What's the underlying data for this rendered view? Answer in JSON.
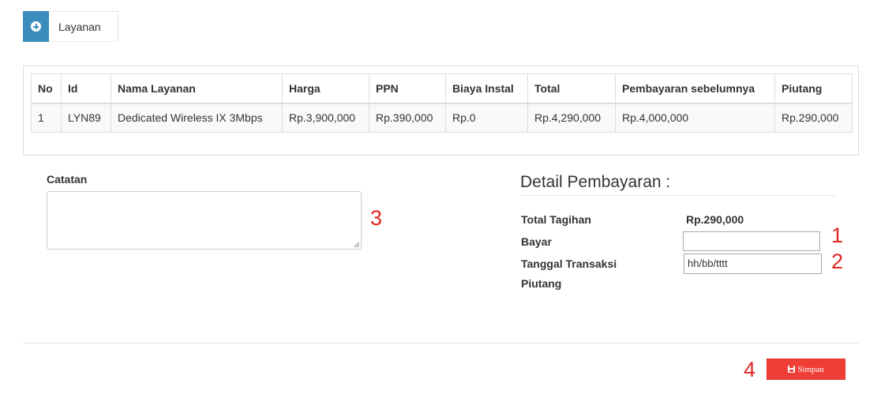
{
  "tab": {
    "label": "Layanan",
    "icon": "plus-circle-icon"
  },
  "table": {
    "headers": [
      "No",
      "Id",
      "Nama Layanan",
      "Harga",
      "PPN",
      "Biaya Instal",
      "Total",
      "Pembayaran sebelumnya",
      "Piutang"
    ],
    "rows": [
      [
        "1",
        "LYN89",
        "Dedicated Wireless IX 3Mbps",
        "Rp.3,900,000",
        "Rp.390,000",
        "Rp.0",
        "Rp.4,290,000",
        "Rp.4,000,000",
        "Rp.290,000"
      ]
    ]
  },
  "catatan": {
    "label": "Catatan",
    "value": ""
  },
  "detail": {
    "title": "Detail Pembayaran :",
    "total_tagihan_label": "Total Tagihan",
    "total_tagihan_value": "Rp.290,000",
    "bayar_label": "Bayar",
    "bayar_value": "",
    "tanggal_label": "Tanggal Transaksi",
    "tanggal_placeholder": "hh/bb/tttt",
    "piutang_label": "Piutang"
  },
  "annotations": [
    "1",
    "2",
    "3",
    "4"
  ],
  "save_button": {
    "label": "Simpan",
    "icon": "floppy-disk-icon"
  },
  "colors": {
    "primary": "#3c8dbc",
    "danger": "#ef3e36",
    "annotation": "#e32626"
  }
}
